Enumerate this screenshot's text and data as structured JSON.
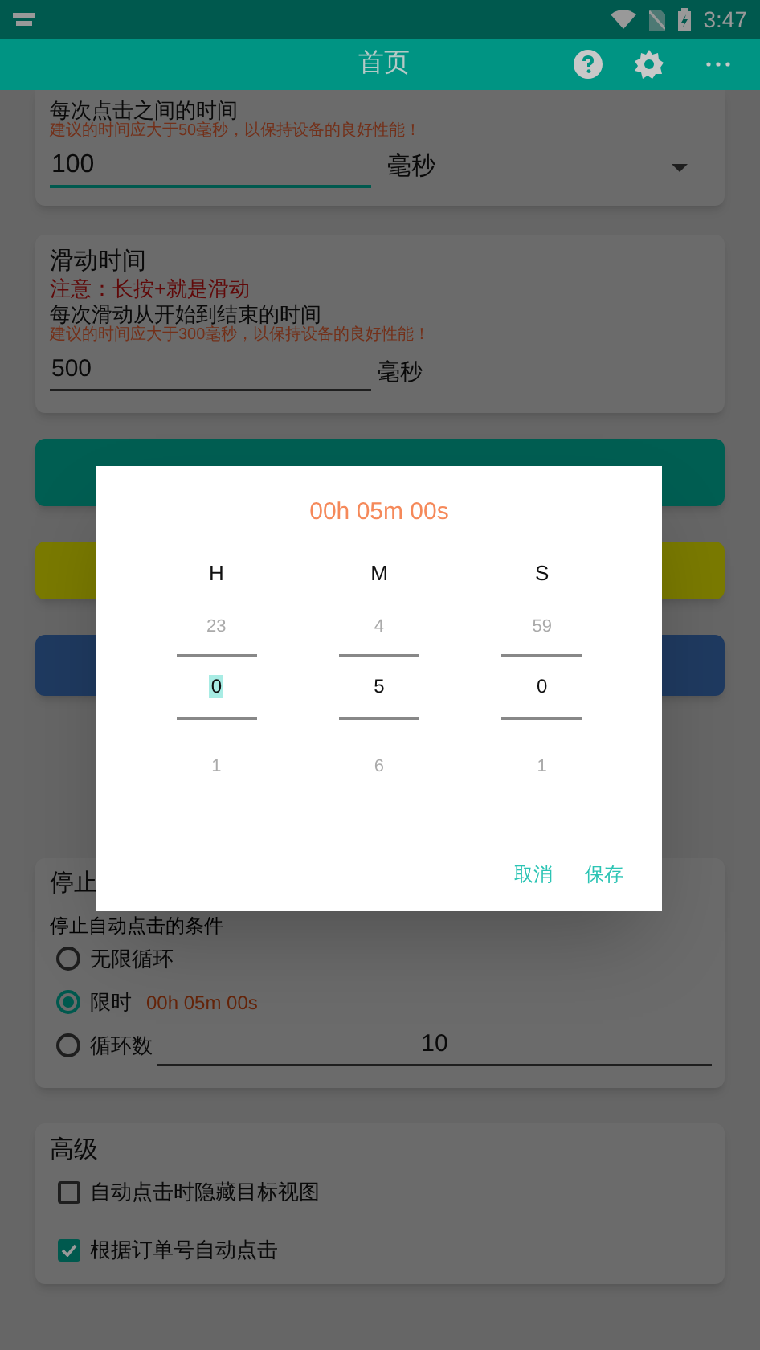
{
  "status_bar": {
    "time": "3:47"
  },
  "app_bar": {
    "title": "首页"
  },
  "click_interval": {
    "label": "每次点击之间的时间",
    "hint": "建议的时间应大于50毫秒，以保持设备的良好性能！",
    "value": "100",
    "unit": "毫秒"
  },
  "swipe_duration": {
    "title": "滑动时间",
    "note": "注意：长按+就是滑动",
    "label": "每次滑动从开始到结束的时间",
    "hint": "建议的时间应大于300毫秒，以保持设备的良好性能！",
    "value": "500",
    "unit": "毫秒"
  },
  "action_buttons": [
    {
      "color": "#005e52"
    },
    {
      "color": "#7a7a00"
    },
    {
      "color": "#1f3a60"
    }
  ],
  "stop": {
    "title": "停止",
    "subtitle": "停止自动点击的条件",
    "options": [
      {
        "kind": "plain",
        "label": "无限循环",
        "selected": false
      },
      {
        "kind": "timer",
        "label": "限时",
        "selected": true,
        "detail": "00h 05m 00s"
      },
      {
        "kind": "count",
        "label": "循环数",
        "selected": false,
        "value": "10"
      }
    ]
  },
  "advanced": {
    "title": "高级",
    "options": [
      {
        "label": "自动点击时隐藏目标视图",
        "checked": false
      },
      {
        "label": "根据订单号自动点击",
        "checked": true
      }
    ]
  },
  "dialog": {
    "title": "00h 05m 00s",
    "columns": [
      {
        "label": "H",
        "prev": "23",
        "value": "0",
        "next": "1",
        "focused": true
      },
      {
        "label": "M",
        "prev": "4",
        "value": "5",
        "next": "6",
        "focused": false
      },
      {
        "label": "S",
        "prev": "59",
        "value": "0",
        "next": "1",
        "focused": false
      }
    ],
    "buttons": [
      "取消",
      "保存"
    ]
  }
}
